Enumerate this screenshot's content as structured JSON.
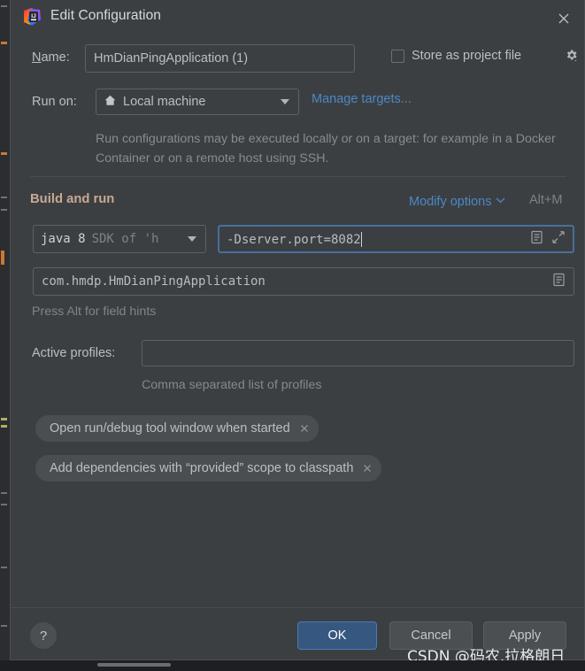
{
  "window": {
    "title": "Edit Configuration",
    "app_icon": "intellij-idea-logo",
    "close_icon": "close-icon"
  },
  "name_row": {
    "label_mnemonic": "N",
    "label_rest": "ame:",
    "value": "HmDianPingApplication (1)",
    "store_as_project_file_label": "Store as project file",
    "store_as_project_file_checked": false,
    "gear_icon": "gear-dropdown-icon"
  },
  "run_on_row": {
    "label": "Run on:",
    "selected": "Local machine",
    "icon": "home-icon",
    "manage_targets_link": "Manage targets...",
    "hint": "Run configurations may be executed locally or on a target: for example in a Docker Container or on a remote host using SSH."
  },
  "build_and_run": {
    "section_title": "Build and run",
    "modify_options_link": "Modify options",
    "modify_options_shortcut": "Alt+M",
    "jdk": {
      "main": "java 8",
      "sub": "SDK of 'h"
    },
    "vm_options": {
      "value": "-Dserver.port=8082",
      "expand_icon": "expand-icon",
      "list_icon": "macro-list-icon",
      "focused": true
    },
    "main_class": {
      "value": "com.hmdp.HmDianPingApplication",
      "list_icon": "macro-list-icon"
    },
    "field_hint": "Press Alt for field hints"
  },
  "active_profiles": {
    "label": "Active profiles:",
    "value": "",
    "hint": "Comma separated list of profiles"
  },
  "option_chips": [
    {
      "label": "Open run/debug tool window when started",
      "remove_icon": "close-icon"
    },
    {
      "label": "Add dependencies with “provided” scope to classpath",
      "remove_icon": "close-icon"
    }
  ],
  "footer": {
    "help_label": "?",
    "ok_label": "OK",
    "cancel_label": "Cancel",
    "apply_label": "Apply"
  },
  "watermark": {
    "text": "CSDN @码农.拉格朗日"
  },
  "colors": {
    "dialog_background": "#3c3f41",
    "link_blue": "#4a88c7",
    "ok_button_blue": "#365880",
    "focus_border": "#466f9d",
    "section_title": "#c6a994",
    "text_primary": "#bcbec4",
    "text_muted": "#85888d"
  }
}
